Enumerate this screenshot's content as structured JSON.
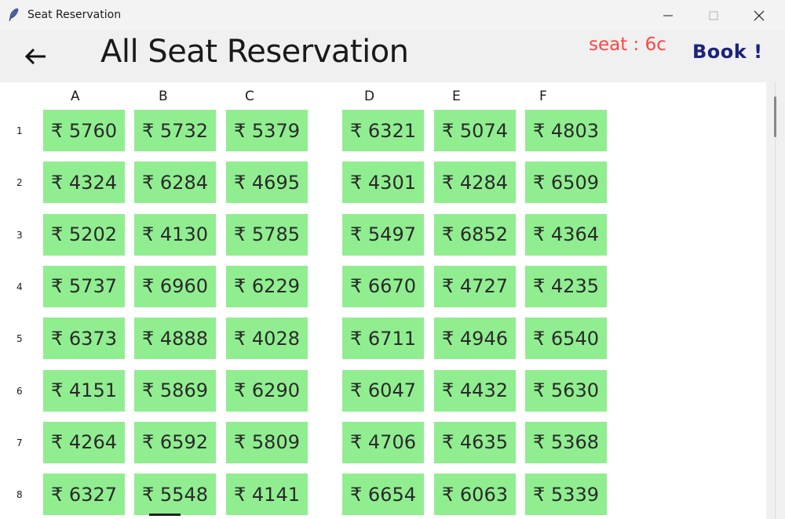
{
  "window": {
    "title": "Seat Reservation"
  },
  "header": {
    "title": "All Seat Reservation",
    "seat_info": "seat : 6c",
    "book_label": "Book !"
  },
  "currency": "₹",
  "columns": [
    "A",
    "B",
    "C",
    "D",
    "E",
    "F"
  ],
  "rows": [
    {
      "num": "1",
      "prices": [
        "5760",
        "5732",
        "5379",
        "6321",
        "5074",
        "4803"
      ]
    },
    {
      "num": "2",
      "prices": [
        "4324",
        "6284",
        "4695",
        "4301",
        "4284",
        "6509"
      ]
    },
    {
      "num": "3",
      "prices": [
        "5202",
        "4130",
        "5785",
        "5497",
        "6852",
        "4364"
      ]
    },
    {
      "num": "4",
      "prices": [
        "5737",
        "6960",
        "6229",
        "6670",
        "4727",
        "4235"
      ]
    },
    {
      "num": "5",
      "prices": [
        "6373",
        "4888",
        "4028",
        "6711",
        "4946",
        "6540"
      ]
    },
    {
      "num": "6",
      "prices": [
        "4151",
        "5869",
        "6290",
        "6047",
        "4432",
        "5630"
      ]
    },
    {
      "num": "7",
      "prices": [
        "4264",
        "6592",
        "5809",
        "4706",
        "4635",
        "5368"
      ]
    },
    {
      "num": "8",
      "prices": [
        "6327",
        "5548",
        "4141",
        "6654",
        "6063",
        "5339"
      ]
    }
  ],
  "colors": {
    "seat_bg": "#90ee90",
    "seat_info": "#ff4444",
    "book": "#1b237e"
  }
}
